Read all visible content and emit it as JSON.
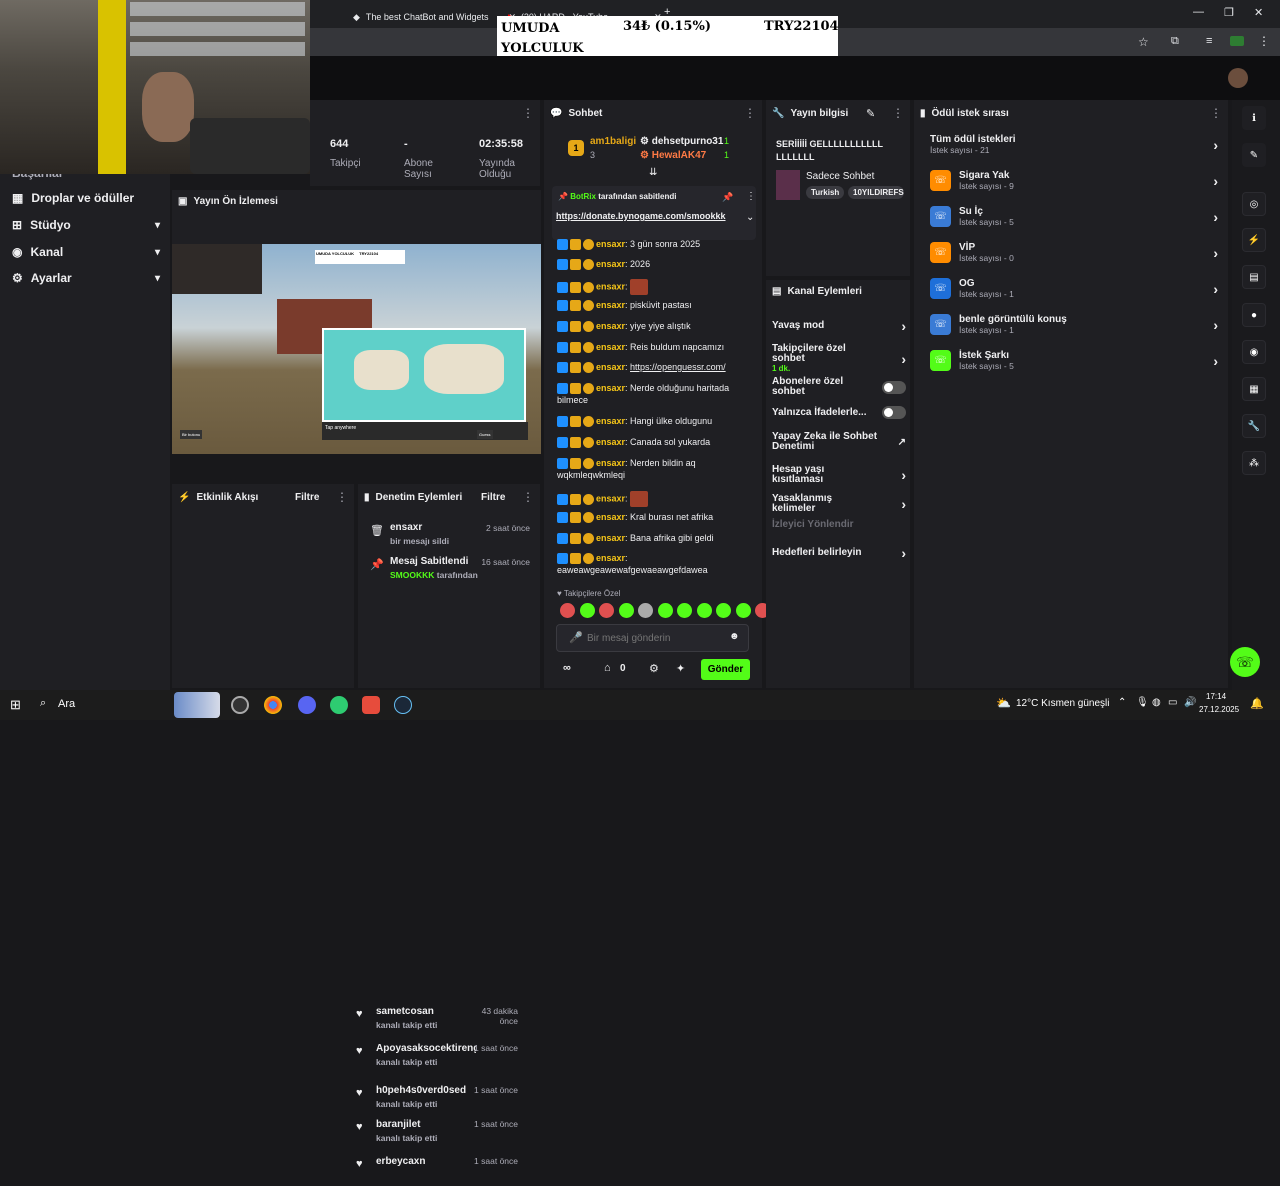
{
  "browser": {
    "tabs": [
      {
        "label": "The best ChatBot and Widgets"
      },
      {
        "label": "(20) HARD - YouTube"
      }
    ],
    "new_tab": "+",
    "win_controls": [
      "—",
      "❐",
      "✕"
    ]
  },
  "ticker": {
    "name": "UMUDA YOLCULUK",
    "amount": "34₺ (0.15%)",
    "code": "TRY22104"
  },
  "stats": [
    {
      "value": "644",
      "label": "Takipçi"
    },
    {
      "value": "-",
      "label": "Abone Sayısı"
    },
    {
      "value": "02:35:58",
      "label": "Yayında Olduğu"
    }
  ],
  "leftnav": {
    "partial_item": "Başarılar",
    "items": [
      {
        "label": "Droplar ve ödüller",
        "has_chevron": false
      },
      {
        "label": "Stüdyo",
        "has_chevron": true
      },
      {
        "label": "Kanal",
        "has_chevron": true
      },
      {
        "label": "Ayarlar",
        "has_chevron": true
      }
    ]
  },
  "preview": {
    "title": "Yayın Ön İzlemesi",
    "mini_ticker": "UMUDA YOLCULUK",
    "mini_code": "TRY22104",
    "map_label": "Tap anywhere",
    "btn_left": "Bir butonu",
    "btn_right": "Guess"
  },
  "activity": {
    "title": "Etkinlik Akışı",
    "filter": "Filtre",
    "items": [
      {
        "name": "sametcosan",
        "sub": "kanalı takip etti",
        "time": "43 dakika önce"
      },
      {
        "name": "Apoyasaksocektirengenc",
        "sub": "kanalı takip etti",
        "time": "1 saat önce"
      },
      {
        "name": "h0peh4s0verd0sed",
        "sub": "kanalı takip etti",
        "time": "1 saat önce"
      },
      {
        "name": "baranjilet",
        "sub": "kanalı takip etti",
        "time": "1 saat önce"
      },
      {
        "name": "erbeycaxn",
        "sub": "",
        "time": "1 saat önce"
      }
    ]
  },
  "modlog": {
    "title": "Denetim Eylemleri",
    "filter": "Filtre",
    "items": [
      {
        "name": "ensaxr",
        "sub": "bir mesajı sildi",
        "time": "2 saat önce"
      },
      {
        "name": "Mesaj Sabitlendi",
        "sub_highlight": "SMOOKKK",
        "sub": "tarafından",
        "time": "16 saat önce"
      }
    ]
  },
  "chat": {
    "title": "Sohbet",
    "leaders": [
      {
        "rank": "1",
        "name": "am1baligi",
        "count": "3"
      },
      {
        "name": "dehsetpurno31",
        "count": "1"
      },
      {
        "name": "HewalAK47",
        "count": "1"
      }
    ],
    "pinned": {
      "by": "BotRix",
      "by_suffix": "tarafından sabitlendi",
      "text": "https://donate.bynogame.com/smookkk"
    },
    "messages": [
      {
        "user": "ensaxr",
        "text": "3 gün sonra 2025",
        "emote": false
      },
      {
        "user": "ensaxr",
        "text": "2026",
        "emote": false
      },
      {
        "user": "ensaxr",
        "text": "",
        "emote": true
      },
      {
        "user": "ensaxr",
        "text": "pisküvit pastası",
        "emote": false
      },
      {
        "user": "ensaxr",
        "text": "yiye yiye alıştık",
        "emote": false
      },
      {
        "user": "ensaxr",
        "text": "Reis buldum napcamızı",
        "emote": false
      },
      {
        "user": "ensaxr",
        "text": "https://openguessr.com/",
        "emote": false,
        "link": true
      },
      {
        "user": "ensaxr",
        "text": "Nerde olduğunu haritada bilmece",
        "emote": false
      },
      {
        "user": "ensaxr",
        "text": "Hangi ülke oldugunu",
        "emote": false
      },
      {
        "user": "ensaxr",
        "text": "Canada sol yukarda",
        "emote": false
      },
      {
        "user": "ensaxr",
        "text": "Nerden bildin aq wqkmleqwkmleqi",
        "emote": false
      },
      {
        "user": "ensaxr",
        "text": "",
        "emote": true
      },
      {
        "user": "ensaxr",
        "text": "Kral burası net afrika",
        "emote": false
      },
      {
        "user": "ensaxr",
        "text": "Bana afrika gibi geldi",
        "emote": false
      },
      {
        "user": "ensaxr",
        "text": "eaweawgeawewafgewaeawgefdawea",
        "emote": false
      }
    ],
    "followers_only": "Takipçilere Özel",
    "input_placeholder": "Bir mesaj gönderin",
    "footer_count": "0",
    "send": "Gönder"
  },
  "streaminfo": {
    "title": "Yayın bilgisi",
    "stream_title": "SERİİİİİ GELLLLLLLLLLLLLLLLLL",
    "category": "Sadece Sohbet",
    "tags": [
      "Turkish",
      "10YILDIREFS"
    ]
  },
  "modactions": {
    "title": "Kanal Eylemleri",
    "rows": [
      {
        "label": "Yavaş mod",
        "type": "chev"
      },
      {
        "label": "Takipçilere özel sohbet",
        "sub": "1 dk.",
        "type": "chev"
      },
      {
        "label": "Abonelere özel sohbet",
        "type": "toggle"
      },
      {
        "label": "Yalnızca İfadelerle...",
        "type": "toggle"
      },
      {
        "label": "Yapay Zeka ile Sohbet Denetimi",
        "type": "ext"
      },
      {
        "label": "Hesap yaşı kısıtlaması",
        "type": "chev"
      },
      {
        "label": "Yasaklanmış kelimeler",
        "type": "chev"
      },
      {
        "label": "İzleyici Yönlendir",
        "type": "disabled"
      },
      {
        "label": "Hedefleri belirleyin",
        "type": "chev"
      }
    ]
  },
  "rewards": {
    "title": "Ödül istek sırası",
    "all": {
      "label": "Tüm ödül istekleri",
      "sub": "İstek sayısı - 21"
    },
    "items": [
      {
        "label": "Sigara Yak",
        "sub": "İstek sayısı - 9",
        "color": "#ff8c00"
      },
      {
        "label": "Su İç",
        "sub": "İstek sayısı - 5",
        "color": "#3a7bd5"
      },
      {
        "label": "VİP",
        "sub": "İstek sayısı - 0",
        "color": "#ff8c00"
      },
      {
        "label": "OG",
        "sub": "İstek sayısı - 1",
        "color": "#1e6fd9"
      },
      {
        "label": "benle görüntülü konuş",
        "sub": "İstek sayısı - 1",
        "color": "#3a7bd5"
      },
      {
        "label": "İstek Şarkı",
        "sub": "İstek sayısı - 5",
        "color": "#53fc18"
      }
    ]
  },
  "taskbar": {
    "search": "Ara",
    "weather": "12°C  Kısmen güneşli",
    "time": "17:14",
    "date": "27.12.2025"
  },
  "colors": {
    "accent": "#53fc18",
    "bg": "#18181b",
    "panel": "#1f1f23"
  }
}
